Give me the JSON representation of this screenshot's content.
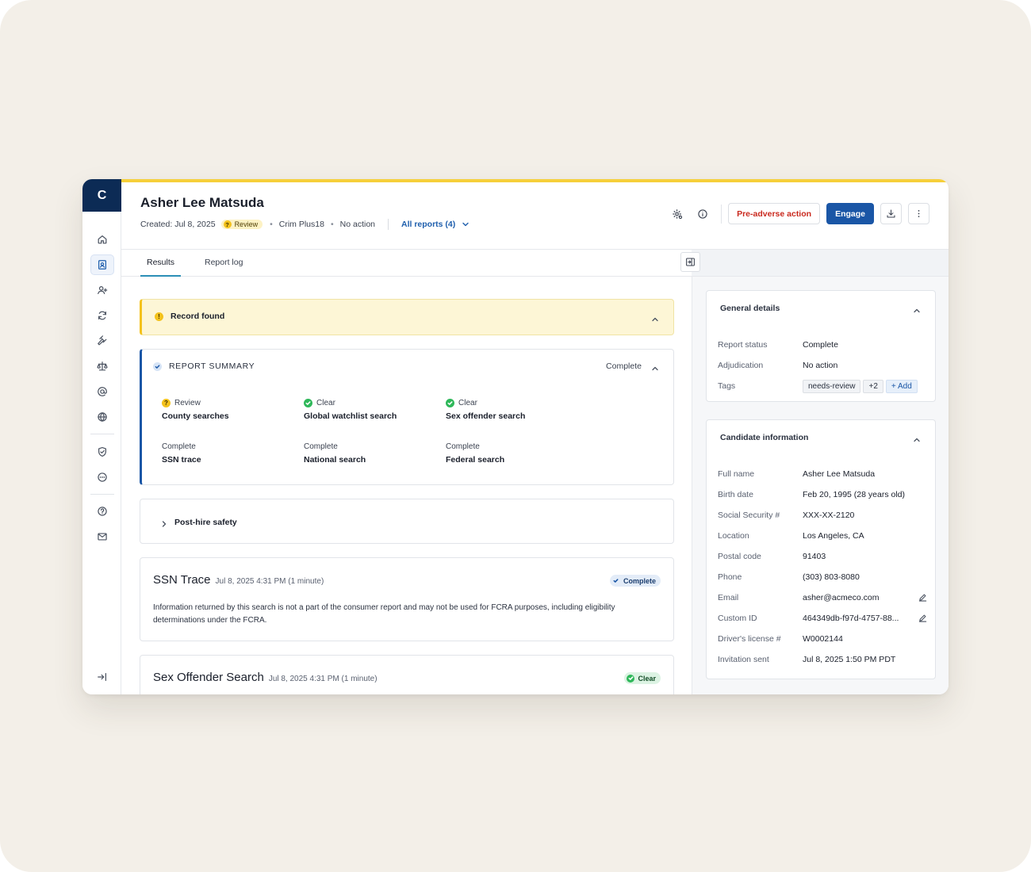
{
  "app": {
    "logo_letter": "C"
  },
  "candidate": {
    "name": "Asher Lee Matsuda",
    "created": "Created: Jul 8, 2025",
    "status_badge": "Review",
    "package": "Crim Plus18",
    "adjudication": "No action",
    "all_reports": "All reports (4)"
  },
  "header": {
    "preadverse_label": "Pre-adverse action",
    "engage_label": "Engage"
  },
  "tabs": [
    {
      "label": "Results",
      "active": true
    },
    {
      "label": "Report log",
      "active": false
    }
  ],
  "record_found": {
    "text": "Record found"
  },
  "summary": {
    "title": "REPORT SUMMARY",
    "status": "Complete",
    "items": [
      {
        "status": "Review",
        "name": "County searches",
        "icon": "review"
      },
      {
        "status": "Clear",
        "name": "Global watchlist search",
        "icon": "clear"
      },
      {
        "status": "Clear",
        "name": "Sex offender search",
        "icon": "clear"
      },
      {
        "status": "Complete",
        "name": "SSN trace",
        "icon": "none"
      },
      {
        "status": "Complete",
        "name": "National search",
        "icon": "none"
      },
      {
        "status": "Complete",
        "name": "Federal search",
        "icon": "none"
      }
    ]
  },
  "post_hire": {
    "label": "Post-hire safety"
  },
  "searches": [
    {
      "title": "SSN Trace",
      "time": "Jul 8, 2025 4:31 PM (1 minute)",
      "badge": "Complete",
      "body": "Information returned by this search is not a part of the consumer report and may not be used for FCRA purposes, including eligibility determinations under the FCRA."
    },
    {
      "title": "Sex Offender Search",
      "time": "Jul 8, 2025 4:31 PM (1 minute)",
      "badge": "Clear"
    }
  ],
  "general_details": {
    "title": "General details",
    "rows": [
      {
        "key": "Report status",
        "value": "Complete"
      },
      {
        "key": "Adjudication",
        "value": "No action"
      }
    ],
    "tags_label": "Tags",
    "tags": [
      "needs-review",
      "+2"
    ],
    "add_label": "+  Add"
  },
  "candidate_info": {
    "title": "Candidate information",
    "rows": [
      {
        "key": "Full name",
        "value": "Asher Lee Matsuda"
      },
      {
        "key": "Birth date",
        "value": "Feb 20, 1995 (28 years old)"
      },
      {
        "key": "Social Security #",
        "value": "XXX-XX-2120"
      },
      {
        "key": "Location",
        "value": "Los Angeles, CA"
      },
      {
        "key": "Postal code",
        "value": "91403"
      },
      {
        "key": "Phone",
        "value": "(303) 803-8080"
      },
      {
        "key": "Email",
        "value": "asher@acmeco.com"
      },
      {
        "key": "Custom ID",
        "value": "464349db-f97d-4757-88..."
      },
      {
        "key": "Driver's license #",
        "value": "W0002144"
      },
      {
        "key": "Invitation sent",
        "value": "Jul 8, 2025 1:50 PM PDT"
      }
    ]
  },
  "colors": {
    "brand_navy": "#0c2b55",
    "accent_yellow": "#f6cf3a",
    "primary_blue": "#1a56a6",
    "danger_red": "#c9291e",
    "clear_green": "#2fb85a"
  }
}
